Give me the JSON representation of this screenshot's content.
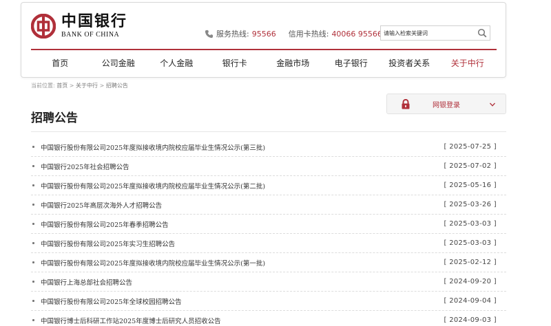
{
  "header": {
    "logo_cn": "中国银行",
    "logo_en": "BANK OF CHINA",
    "service_label": "服务热线:",
    "service_number": "95566",
    "card_label": "信用卡热线:",
    "card_number": "40066 95566",
    "search_placeholder": "请输入检索关键词"
  },
  "nav": {
    "items": [
      {
        "label": "首页"
      },
      {
        "label": "公司金融"
      },
      {
        "label": "个人金融"
      },
      {
        "label": "银行卡"
      },
      {
        "label": "金融市场"
      },
      {
        "label": "电子银行"
      },
      {
        "label": "投资者关系"
      },
      {
        "label": "关于中行"
      }
    ]
  },
  "breadcrumb": {
    "prefix": "当前位置:",
    "home": "首页",
    "sep1": " > ",
    "section": "关于中行",
    "sep2": " > ",
    "current": "招聘公告"
  },
  "ebank": {
    "label": "网银登录"
  },
  "page": {
    "title": "招聘公告"
  },
  "notices": [
    {
      "title": "中国银行股份有限公司2025年度拟接收境内院校应届毕业生情况公示(第三批)",
      "date": "[ 2025-07-25 ]"
    },
    {
      "title": "中国银行2025年社会招聘公告",
      "date": "[ 2025-07-02 ]"
    },
    {
      "title": "中国银行股份有限公司2025年度拟接收境内院校应届毕业生情况公示(第二批)",
      "date": "[ 2025-05-16 ]"
    },
    {
      "title": "中国银行2025年高层次海外人才招聘公告",
      "date": "[ 2025-03-26 ]"
    },
    {
      "title": "中国银行股份有限公司2025年春季招聘公告",
      "date": "[ 2025-03-03 ]"
    },
    {
      "title": "中国银行股份有限公司2025年实习生招聘公告",
      "date": "[ 2025-03-03 ]"
    },
    {
      "title": "中国银行股份有限公司2025年度拟接收境内院校应届毕业生情况公示(第一批)",
      "date": "[ 2025-02-12 ]"
    },
    {
      "title": "中国银行上海总部社会招聘公告",
      "date": "[ 2024-09-20 ]"
    },
    {
      "title": "中国银行股份有限公司2025年全球校园招聘公告",
      "date": "[ 2024-09-04 ]"
    },
    {
      "title": "中国银行博士后科研工作站2025年度博士后研究人员招收公告",
      "date": "[ 2024-09-03 ]"
    }
  ],
  "colors": {
    "brand_red": "#b0303a",
    "text": "#333333"
  },
  "icons": [
    "bank-of-china-logo-icon",
    "phone-icon",
    "search-icon",
    "lock-icon",
    "chevron-down-icon"
  ]
}
